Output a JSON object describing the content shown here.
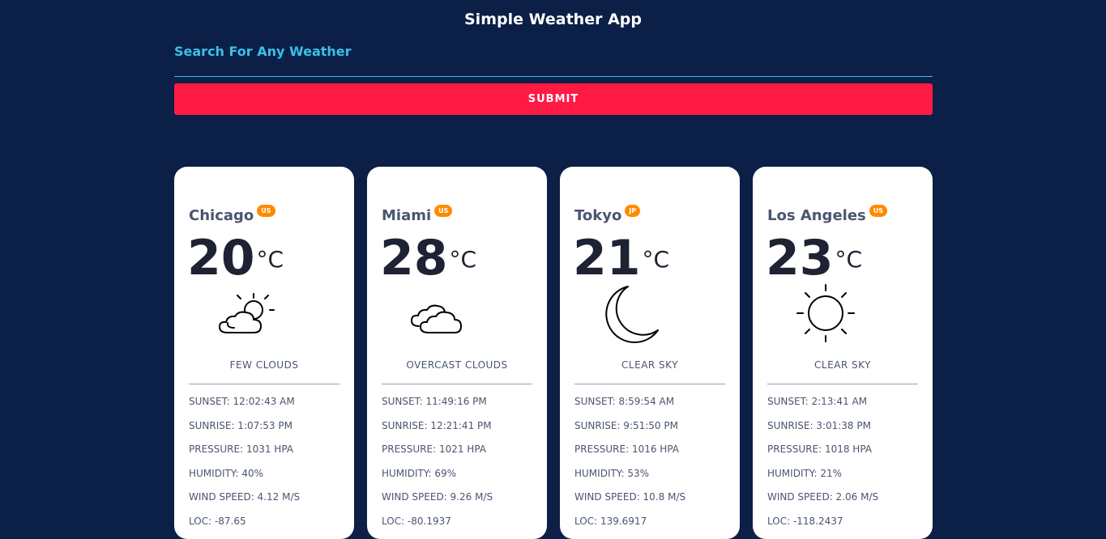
{
  "header": {
    "title": "Simple Weather App"
  },
  "search": {
    "label": "Search For Any Weather",
    "value": "",
    "submit_label": "SUBMIT"
  },
  "cards": [
    {
      "city": "Chicago",
      "country": "US",
      "temp": "20",
      "unit": "°C",
      "icon": "partly-cloudy-day-icon",
      "description": "FEW CLOUDS",
      "sunset": "SUNSET: 12:02:43 AM",
      "sunrise": "SUNRISE: 1:07:53 PM",
      "pressure": "PRESSURE: 1031 HPA",
      "humidity": "HUMIDITY: 40%",
      "wind": "WIND SPEED: 4.12 M/S",
      "loc": "LOC: -87.65"
    },
    {
      "city": "Miami",
      "country": "US",
      "temp": "28",
      "unit": "°C",
      "icon": "clouds-icon",
      "description": "OVERCAST CLOUDS",
      "sunset": "SUNSET: 11:49:16 PM",
      "sunrise": "SUNRISE: 12:21:41 PM",
      "pressure": "PRESSURE: 1021 HPA",
      "humidity": "HUMIDITY: 69%",
      "wind": "WIND SPEED: 9.26 M/S",
      "loc": "LOC: -80.1937"
    },
    {
      "city": "Tokyo",
      "country": "JP",
      "temp": "21",
      "unit": "°C",
      "icon": "moon-icon",
      "description": "CLEAR SKY",
      "sunset": "SUNSET: 8:59:54 AM",
      "sunrise": "SUNRISE: 9:51:50 PM",
      "pressure": "PRESSURE: 1016 HPA",
      "humidity": "HUMIDITY: 53%",
      "wind": "WIND SPEED: 10.8 M/S",
      "loc": "LOC: 139.6917"
    },
    {
      "city": "Los Angeles",
      "country": "US",
      "temp": "23",
      "unit": "°C",
      "icon": "sun-icon",
      "description": "CLEAR SKY",
      "sunset": "SUNSET: 2:13:41 AM",
      "sunrise": "SUNRISE: 3:01:38 PM",
      "pressure": "PRESSURE: 1018 HPA",
      "humidity": "HUMIDITY: 21%",
      "wind": "WIND SPEED: 2.06 M/S",
      "loc": "LOC: -118.2437"
    }
  ],
  "colors": {
    "background": "#0b1f47",
    "accent": "#3cc0e8",
    "submit": "#ff1a44",
    "badge": "#ff8a00"
  }
}
